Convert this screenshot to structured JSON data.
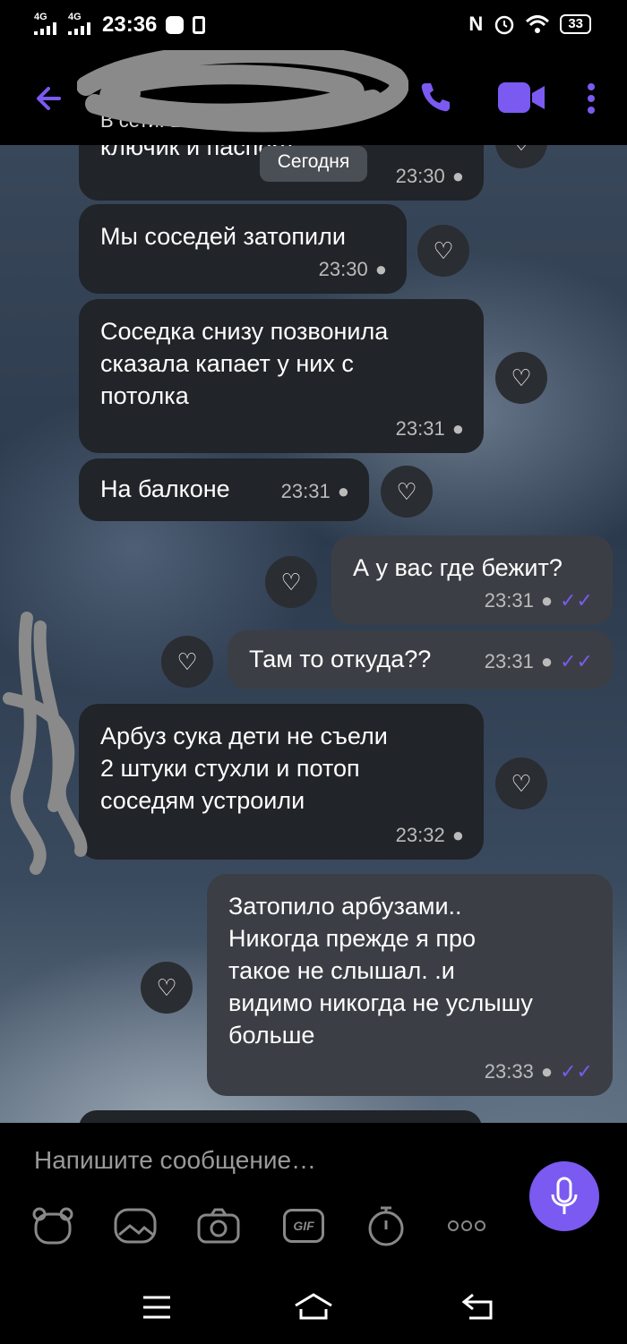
{
  "status_bar": {
    "network1": "4G",
    "network2": "4G",
    "time": "23:36",
    "battery": "33"
  },
  "header": {
    "subtitle": "В сети: 1 мин назад"
  },
  "day_label": "Сегодня",
  "messages": [
    {
      "text": "ключик и паспорт",
      "time": "23:30",
      "dir": "in"
    },
    {
      "text": "Мы соседей затопили",
      "time": "23:30",
      "dir": "in"
    },
    {
      "lines": [
        "Соседка снизу позвонила",
        "сказала капает у них с",
        "потолка"
      ],
      "time": "23:31",
      "dir": "in"
    },
    {
      "text": "На балконе",
      "time": "23:31",
      "dir": "in"
    },
    {
      "text": "А у вас где бежит?",
      "time": "23:31",
      "dir": "out"
    },
    {
      "text": "Там то откуда??",
      "time": "23:31",
      "dir": "out"
    },
    {
      "lines": [
        "Арбуз сука дети не съели",
        "2 штуки стухли и потоп",
        "соседям устроили"
      ],
      "time": "23:32",
      "dir": "in"
    },
    {
      "lines": [
        "Затопило арбузами..",
        "Никогда прежде я про",
        "такое не слышал. .и",
        "видимо никогда не услышу",
        "больше"
      ],
      "time": "23:33",
      "dir": "out"
    }
  ],
  "composer": {
    "placeholder": "Напишите сообщение…",
    "gif_label": "GIF"
  },
  "colors": {
    "accent": "#7a5af0",
    "bubble_in": "#212428",
    "bubble_out": "#3b3f45"
  }
}
